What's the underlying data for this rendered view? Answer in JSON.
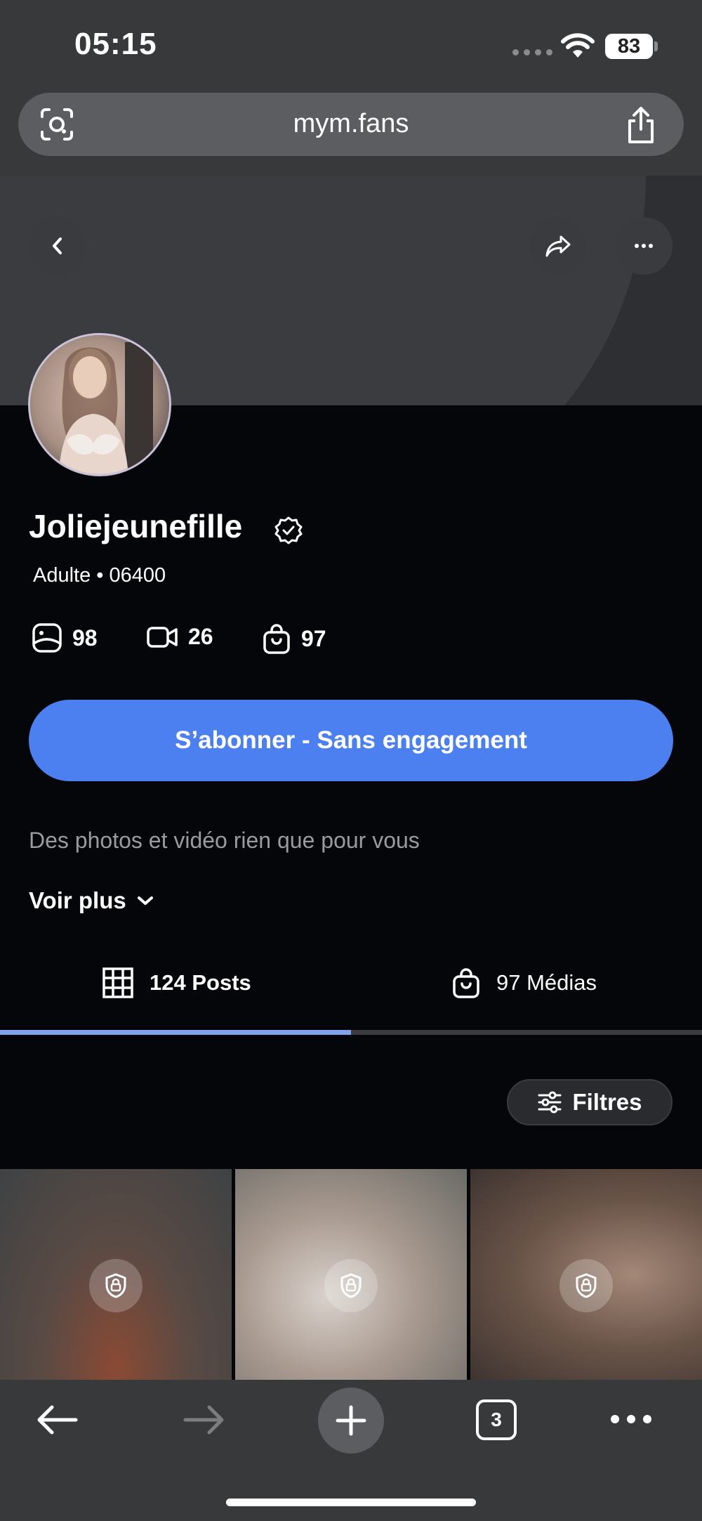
{
  "status_bar": {
    "time": "05:15",
    "battery": "83"
  },
  "browser": {
    "url": "mym.fans",
    "open_tabs": "3"
  },
  "profile": {
    "name": "Joliejeunefille",
    "subline": "Adulte • 06400",
    "stats": {
      "photos": "98",
      "videos": "26",
      "purchases": "97"
    },
    "subscribe_label": "S’abonner - Sans engagement",
    "bio": "Des photos et vidéo rien que pour vous",
    "see_more": "Voir plus"
  },
  "tabs": [
    {
      "label": "124 Posts",
      "active": true
    },
    {
      "label": "97 Médias",
      "active": false
    }
  ],
  "filters_label": "Filtres",
  "colors": {
    "accent": "#4c80f0",
    "tab_indicator": "#7ea4ec",
    "background": "#05060a",
    "chrome": "#38393b"
  },
  "grid_icons": [
    "shield-lock-icon",
    "shield-lock-icon",
    "shield-lock-icon"
  ]
}
